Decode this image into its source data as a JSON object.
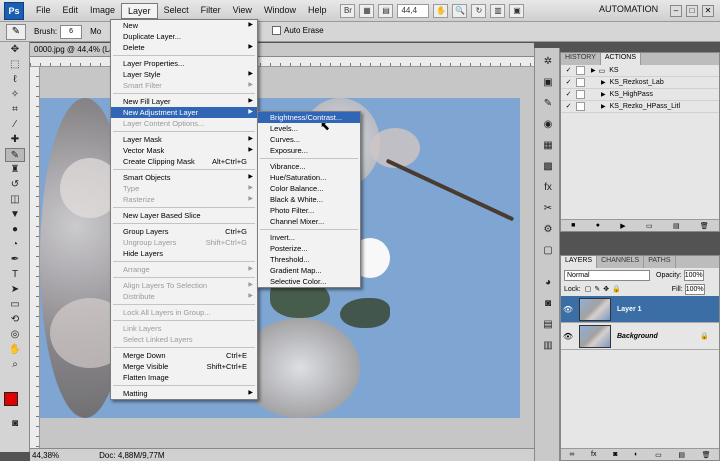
{
  "menubar": {
    "logo": "Ps",
    "items": [
      "File",
      "Edit",
      "Image",
      "Layer",
      "Select",
      "Filter",
      "View",
      "Window",
      "Help"
    ],
    "active": "Layer",
    "zoom": "44,4",
    "workspace": "AUTOMATION"
  },
  "options": {
    "brush_label": "Brush:",
    "brush_size": "6",
    "mode_label": "Mo",
    "auto_erase": "Auto Erase"
  },
  "document": {
    "tab_title": "0000.jpg @ 44,4% (La",
    "status_zoom": "44,38%",
    "status_doc": "Doc: 4,88M/9,77M"
  },
  "layer_menu": [
    {
      "label": "New",
      "arrow": true
    },
    {
      "label": "Duplicate Layer..."
    },
    {
      "label": "Delete",
      "arrow": true
    },
    {
      "sep": true
    },
    {
      "label": "Layer Properties..."
    },
    {
      "label": "Layer Style",
      "arrow": true
    },
    {
      "label": "Smart Filter",
      "arrow": true,
      "disabled": true
    },
    {
      "sep": true
    },
    {
      "label": "New Fill Layer",
      "arrow": true
    },
    {
      "label": "New Adjustment Layer",
      "arrow": true,
      "highlight": true
    },
    {
      "label": "Layer Content Options...",
      "disabled": true
    },
    {
      "sep": true
    },
    {
      "label": "Layer Mask",
      "arrow": true
    },
    {
      "label": "Vector Mask",
      "arrow": true
    },
    {
      "label": "Create Clipping Mask",
      "shortcut": "Alt+Ctrl+G"
    },
    {
      "sep": true
    },
    {
      "label": "Smart Objects",
      "arrow": true
    },
    {
      "label": "Type",
      "arrow": true,
      "disabled": true
    },
    {
      "label": "Rasterize",
      "arrow": true,
      "disabled": true
    },
    {
      "sep": true
    },
    {
      "label": "New Layer Based Slice"
    },
    {
      "sep": true
    },
    {
      "label": "Group Layers",
      "shortcut": "Ctrl+G"
    },
    {
      "label": "Ungroup Layers",
      "shortcut": "Shift+Ctrl+G",
      "disabled": true
    },
    {
      "label": "Hide Layers"
    },
    {
      "sep": true
    },
    {
      "label": "Arrange",
      "arrow": true,
      "disabled": true
    },
    {
      "sep": true
    },
    {
      "label": "Align Layers To Selection",
      "arrow": true,
      "disabled": true
    },
    {
      "label": "Distribute",
      "arrow": true,
      "disabled": true
    },
    {
      "sep": true
    },
    {
      "label": "Lock All Layers in Group...",
      "disabled": true
    },
    {
      "sep": true
    },
    {
      "label": "Link Layers",
      "disabled": true
    },
    {
      "label": "Select Linked Layers",
      "disabled": true
    },
    {
      "sep": true
    },
    {
      "label": "Merge Down",
      "shortcut": "Ctrl+E"
    },
    {
      "label": "Merge Visible",
      "shortcut": "Shift+Ctrl+E"
    },
    {
      "label": "Flatten Image"
    },
    {
      "sep": true
    },
    {
      "label": "Matting",
      "arrow": true
    }
  ],
  "adjustment_menu": [
    {
      "label": "Brightness/Contrast...",
      "highlight": true
    },
    {
      "label": "Levels..."
    },
    {
      "label": "Curves..."
    },
    {
      "label": "Exposure..."
    },
    {
      "sep": true
    },
    {
      "label": "Vibrance..."
    },
    {
      "label": "Hue/Saturation..."
    },
    {
      "label": "Color Balance..."
    },
    {
      "label": "Black & White..."
    },
    {
      "label": "Photo Filter..."
    },
    {
      "label": "Channel Mixer..."
    },
    {
      "sep": true
    },
    {
      "label": "Invert..."
    },
    {
      "label": "Posterize..."
    },
    {
      "label": "Threshold..."
    },
    {
      "label": "Gradient Map..."
    },
    {
      "label": "Selective Color..."
    }
  ],
  "history_panel": {
    "tabs": [
      "HISTORY",
      "ACTIONS"
    ],
    "actions": [
      {
        "label": "KS",
        "folder": true
      },
      {
        "label": "KS_Rezkost_Lab"
      },
      {
        "label": "KS_HighPass"
      },
      {
        "label": "KS_Rezko_HPass_Litl"
      }
    ]
  },
  "layers_panel": {
    "tabs": [
      "LAYERS",
      "CHANNELS",
      "PATHS"
    ],
    "blend_mode": "Normal",
    "opacity_label": "Opacity:",
    "opacity": "100%",
    "lock_label": "Lock:",
    "fill_label": "Fill:",
    "fill": "100%",
    "layers": [
      {
        "name": "Layer 1",
        "selected": true
      },
      {
        "name": "Background",
        "selected": false
      }
    ]
  },
  "colors": {
    "foreground": "#e00000",
    "background": "#ffffff",
    "menu_highlight": "#3166b7"
  }
}
